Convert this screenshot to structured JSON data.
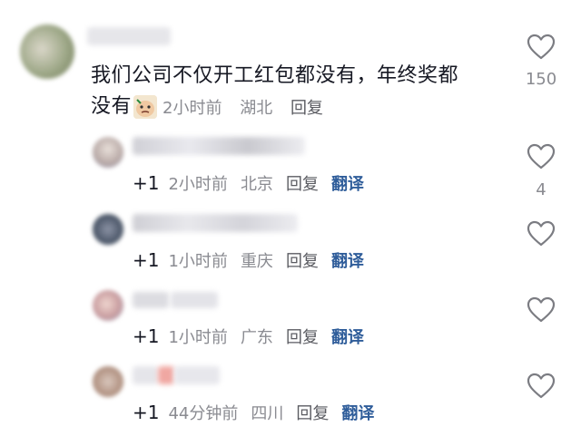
{
  "main_comment": {
    "text_line1": "我们公司不仅开工红包都没有，年终奖都",
    "text_line2": "没有",
    "emoji": "sticker-face",
    "time": "2小时前",
    "location": "湖北",
    "reply_label": "回复",
    "like_count": "150"
  },
  "replies": [
    {
      "plus": "+1",
      "time": "2小时前",
      "location": "北京",
      "reply_label": "回复",
      "translate_label": "翻译",
      "like_count": "4"
    },
    {
      "plus": "+1",
      "time": "1小时前",
      "location": "重庆",
      "reply_label": "回复",
      "translate_label": "翻译",
      "like_count": ""
    },
    {
      "plus": "+1",
      "time": "1小时前",
      "location": "广东",
      "reply_label": "回复",
      "translate_label": "翻译",
      "like_count": ""
    },
    {
      "plus": "+1",
      "time": "44分钟前",
      "location": "四川",
      "reply_label": "回复",
      "translate_label": "翻译",
      "like_count": ""
    }
  ],
  "colors": {
    "text": "#161823",
    "meta": "#8a8b91",
    "translate": "#2f5d9a",
    "heart": "#7b7c82"
  }
}
